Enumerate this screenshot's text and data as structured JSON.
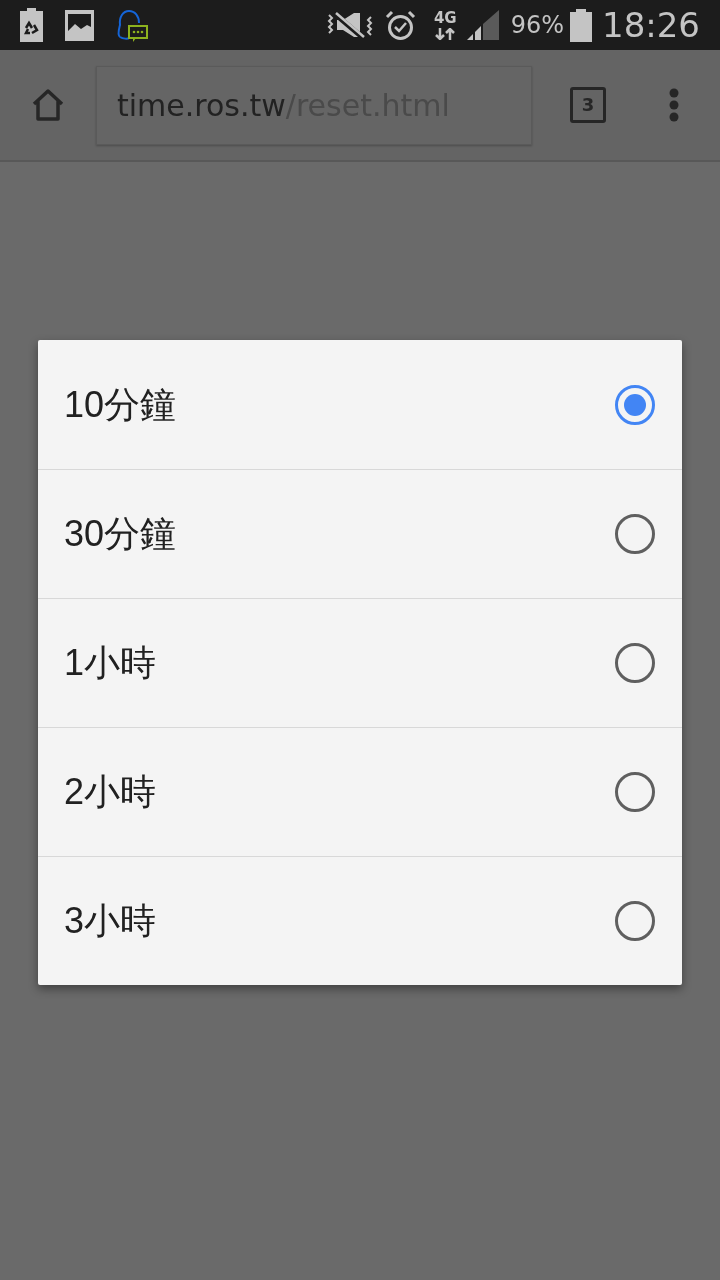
{
  "status_bar": {
    "network": "4G",
    "battery": "96%",
    "time": "18:26"
  },
  "browser": {
    "url_host": "time.ros.tw",
    "url_path": "/reset.html",
    "tab_count": "3"
  },
  "dialog": {
    "options": [
      {
        "label": "10分鐘",
        "selected": true
      },
      {
        "label": "30分鐘",
        "selected": false
      },
      {
        "label": "1小時",
        "selected": false
      },
      {
        "label": "2小時",
        "selected": false
      },
      {
        "label": "3小時",
        "selected": false
      }
    ]
  }
}
